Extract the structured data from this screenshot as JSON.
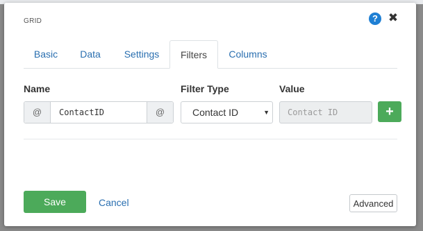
{
  "dialog": {
    "title": "GRID",
    "help_symbol": "?",
    "close_symbol": "✖"
  },
  "tabs": [
    {
      "label": "Basic",
      "active": false
    },
    {
      "label": "Data",
      "active": false
    },
    {
      "label": "Settings",
      "active": false
    },
    {
      "label": "Filters",
      "active": true
    },
    {
      "label": "Columns",
      "active": false
    }
  ],
  "filters": {
    "name_label": "Name",
    "filter_type_label": "Filter Type",
    "value_label": "Value",
    "row": {
      "prefix": "@",
      "name_value": "ContactID",
      "suffix": "@",
      "filter_type_selected": "Contact ID",
      "value_placeholder": "Contact ID"
    },
    "add_symbol": "+"
  },
  "footer": {
    "save_label": "Save",
    "cancel_label": "Cancel",
    "advanced_label": "Advanced"
  },
  "colors": {
    "accent_green": "#4caa5a",
    "link_blue": "#2a6fb0",
    "help_blue": "#1e7fd4"
  }
}
